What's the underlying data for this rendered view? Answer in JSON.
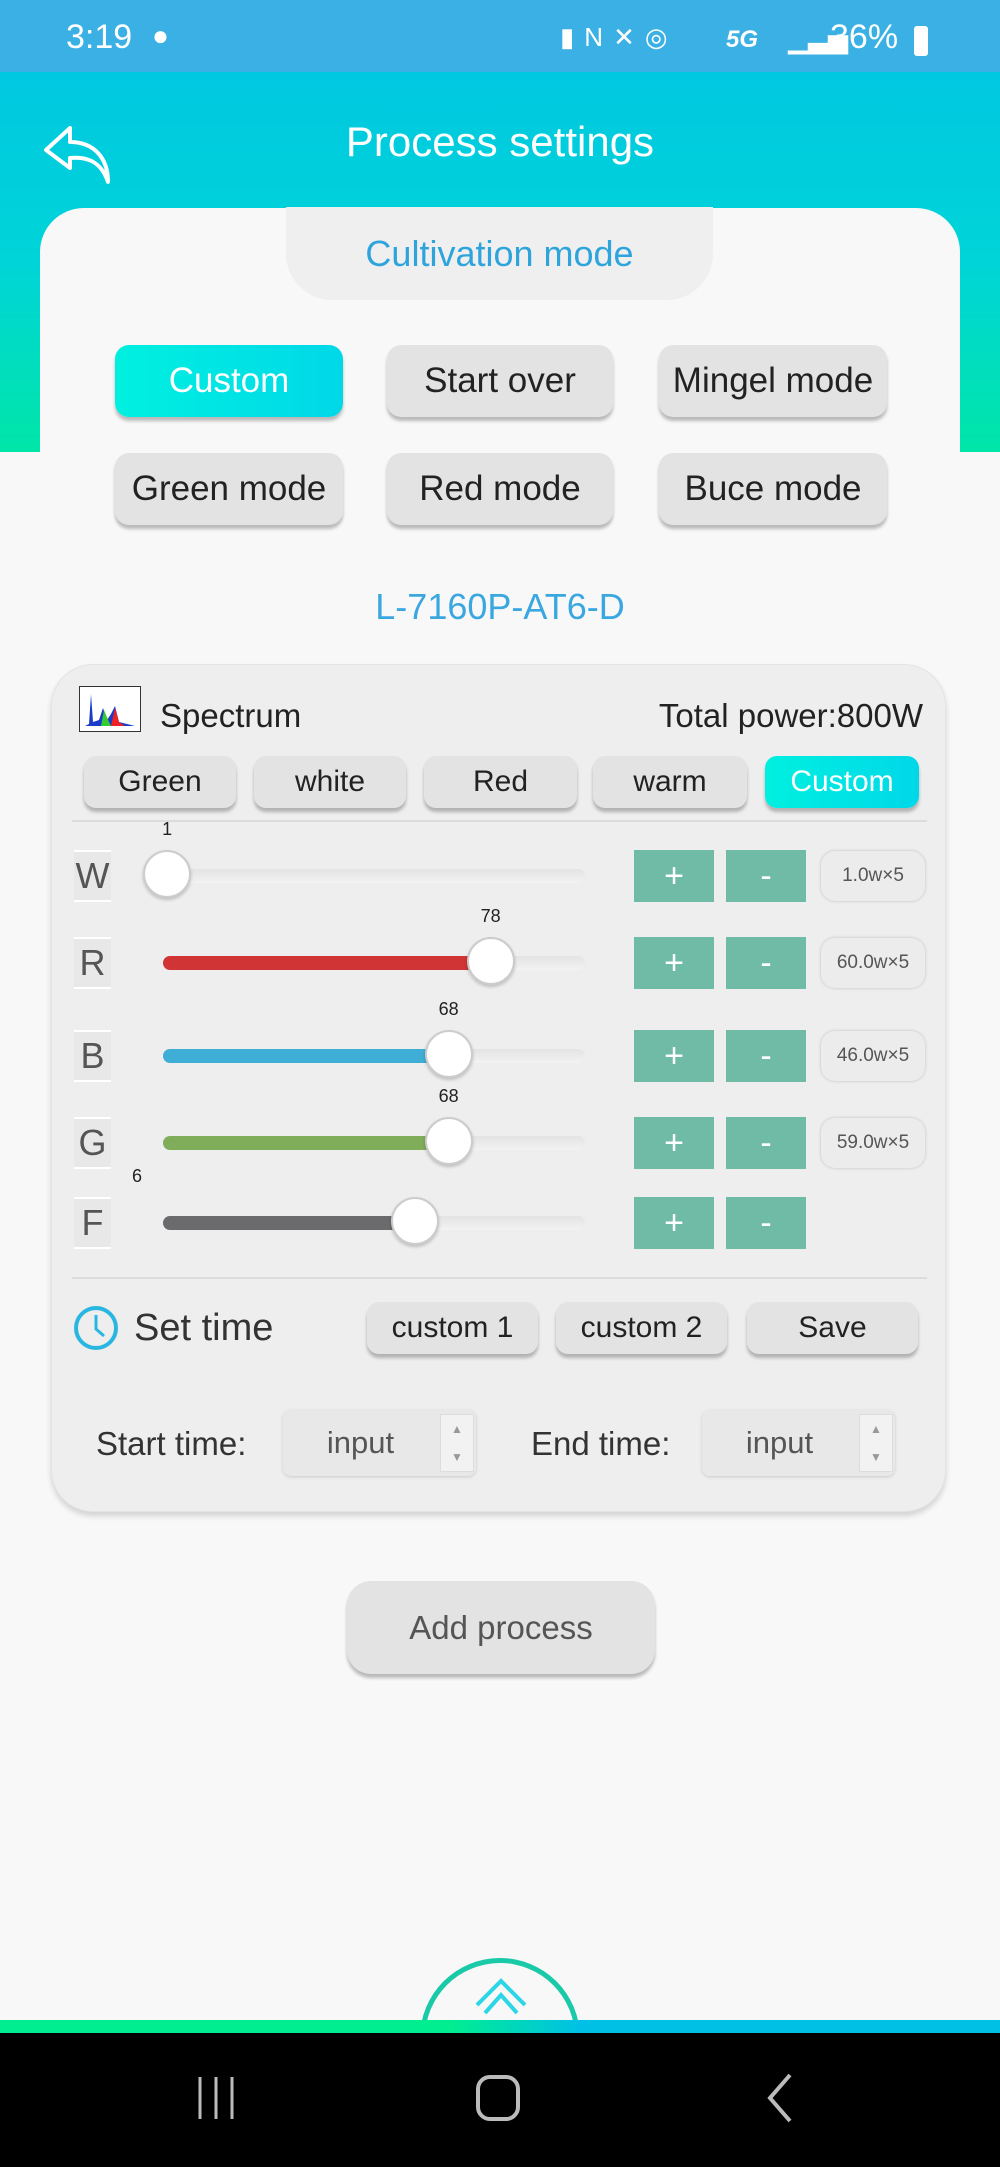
{
  "status_bar": {
    "time": "3:19",
    "network": "5G",
    "battery": "36%"
  },
  "header": {
    "title": "Process settings",
    "back_icon": "reply-arrow-icon"
  },
  "section_tab": "Cultivation mode",
  "modes": [
    {
      "label": "Custom",
      "active": true
    },
    {
      "label": "Start over",
      "active": false
    },
    {
      "label": "Mingel mode",
      "active": false
    },
    {
      "label": "Green mode",
      "active": false
    },
    {
      "label": "Red mode",
      "active": false
    },
    {
      "label": "Buce mode",
      "active": false
    }
  ],
  "model": "L-7160P-AT6-D",
  "panel": {
    "spectrum_label": "Spectrum",
    "total_power": "Total power:800W",
    "presets": [
      {
        "label": "Green",
        "active": false
      },
      {
        "label": "white",
        "active": false
      },
      {
        "label": "Red",
        "active": false
      },
      {
        "label": "warm",
        "active": false
      },
      {
        "label": "Custom",
        "active": true
      }
    ],
    "channels": [
      {
        "letter": "W",
        "value": "1",
        "level": 1,
        "max": 100,
        "color": "#cccccc",
        "watts": "1.0w×5"
      },
      {
        "letter": "R",
        "value": "78",
        "level": 78,
        "max": 100,
        "color": "#d03434",
        "watts": "60.0w×5"
      },
      {
        "letter": "B",
        "value": "68",
        "level": 68,
        "max": 100,
        "color": "#3eaed6",
        "watts": "46.0w×5"
      },
      {
        "letter": "G",
        "value": "68",
        "level": 68,
        "max": 100,
        "color": "#7fad5a",
        "watts": "59.0w×5"
      },
      {
        "letter": "F",
        "value": "6",
        "level": 6,
        "max": 10,
        "color": "#6b6b6d",
        "watts": ""
      }
    ],
    "plus": "+",
    "minus": "-",
    "set_time": "Set time",
    "time_buttons": [
      "custom 1",
      "custom 2",
      "Save"
    ],
    "start_label": "Start time:",
    "end_label": "End time:",
    "start_placeholder": "input",
    "end_placeholder": "input"
  },
  "add_process": "Add process",
  "colors": {
    "accent": "#00e0e6",
    "model_text": "#3aa7e0",
    "step_buttons": "#6fbba5"
  }
}
